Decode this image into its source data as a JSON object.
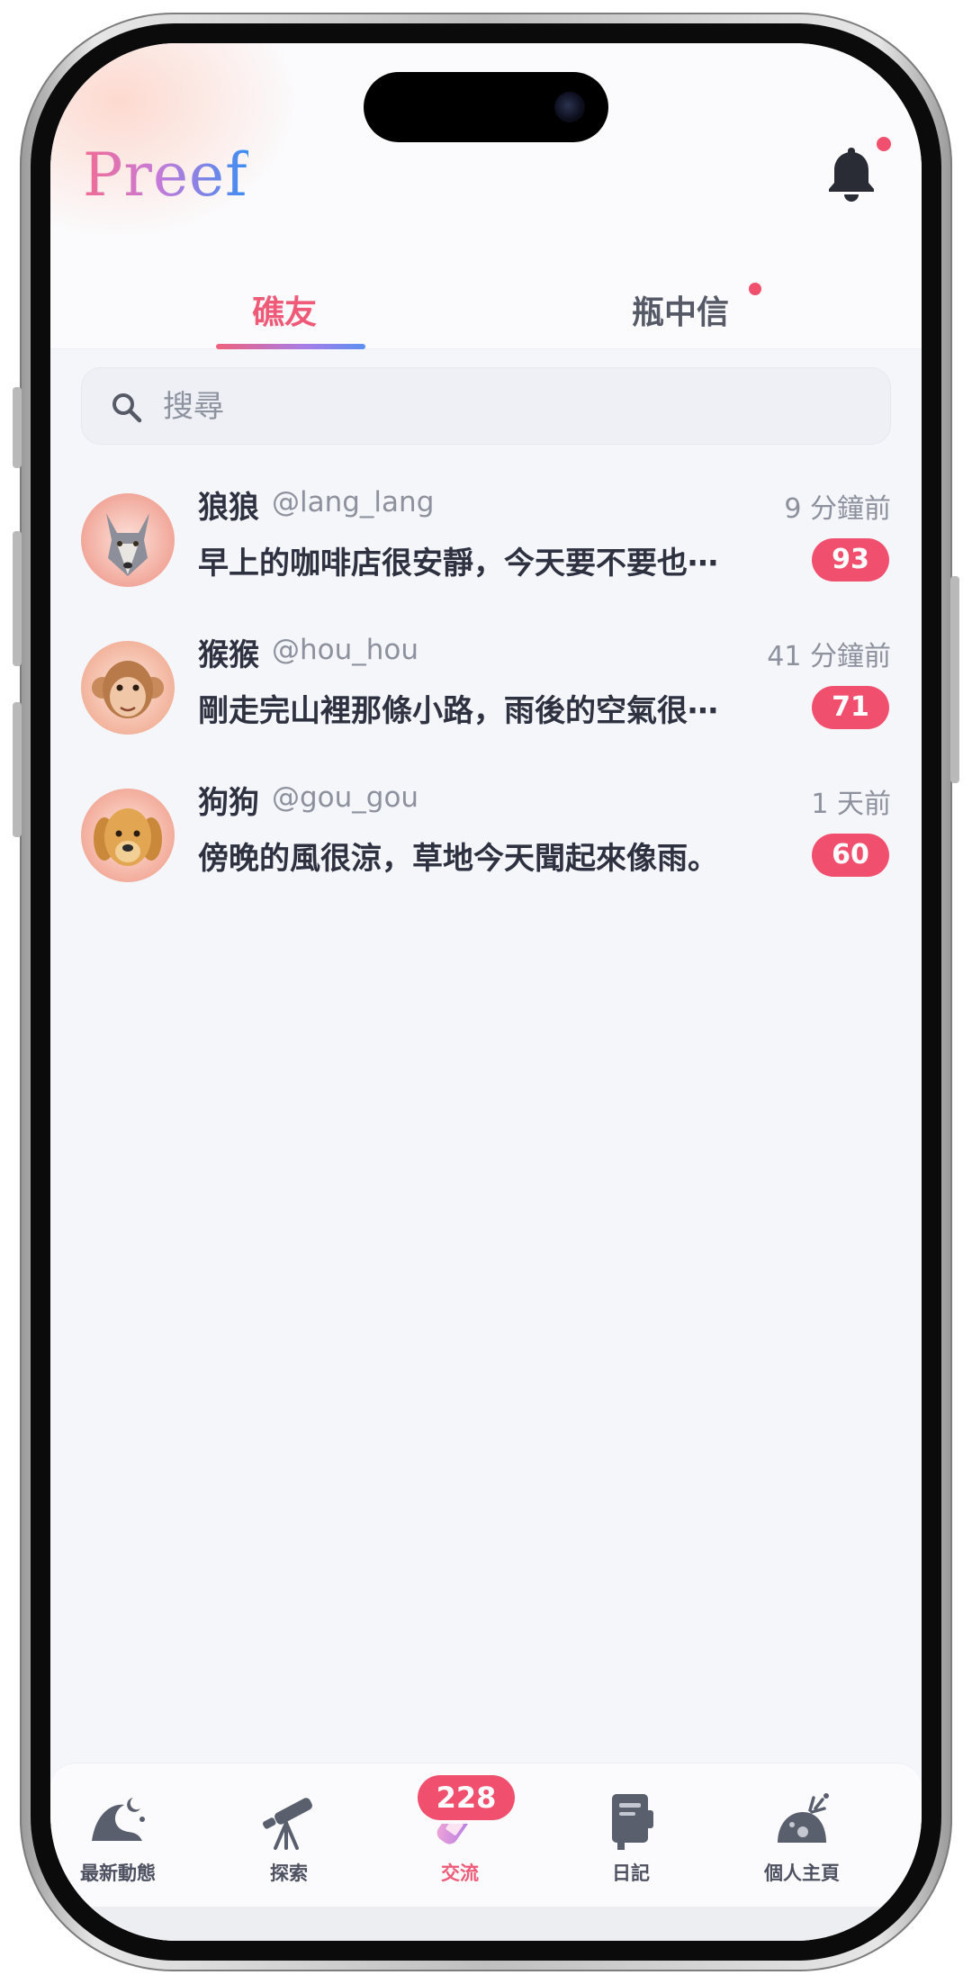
{
  "app": {
    "logo": "Preef",
    "brand_gradient": [
      "#f06d95",
      "#c77ad8",
      "#3a8ef2"
    ],
    "accent": "#f0506e"
  },
  "header": {
    "notification_icon": "bell-icon",
    "has_unread": true
  },
  "tabs": [
    {
      "label": "礁友",
      "active": true
    },
    {
      "label": "瓶中信",
      "active": false,
      "has_dot": true
    }
  ],
  "search": {
    "placeholder": "搜尋",
    "icon": "search-icon"
  },
  "chats": [
    {
      "name": "狼狼",
      "handle": "@lang_lang",
      "time": "9 分鐘前",
      "preview": "早上的咖啡店很安靜，今天要不要也⋯",
      "unread": "93",
      "avatar": "wolf-avatar"
    },
    {
      "name": "猴猴",
      "handle": "@hou_hou",
      "time": "41 分鐘前",
      "preview": "剛走完山裡那條小路，雨後的空氣很⋯",
      "unread": "71",
      "avatar": "monkey-avatar"
    },
    {
      "name": "狗狗",
      "handle": "@gou_gou",
      "time": "1 天前",
      "preview": "傍晚的風很涼，草地今天聞起來像雨。",
      "unread": "60",
      "avatar": "dog-avatar"
    }
  ],
  "bottom_nav": {
    "items": [
      {
        "label": "最新動態",
        "icon": "wave-moon-icon",
        "active": false
      },
      {
        "label": "探索",
        "icon": "telescope-icon",
        "active": false
      },
      {
        "label": "交流",
        "icon": "message-bottle-icon",
        "active": true
      },
      {
        "label": "日記",
        "icon": "diary-book-icon",
        "active": false
      },
      {
        "label": "個人主頁",
        "icon": "coral-home-icon",
        "active": false
      }
    ],
    "badge": "228"
  }
}
